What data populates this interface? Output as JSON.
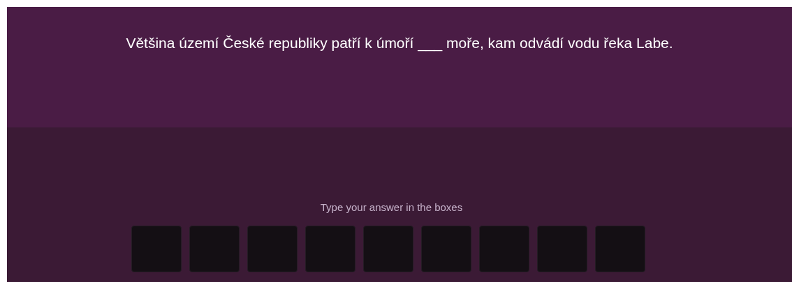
{
  "question": {
    "text": "Většina území České republiky patří k úmoří ___ moře, kam odvádí vodu řeka Labe."
  },
  "answer": {
    "hint": "Type your answer in the boxes",
    "boxes": [
      {
        "kind": "letter"
      },
      {
        "kind": "letter"
      },
      {
        "kind": "letter"
      },
      {
        "kind": "letter"
      },
      {
        "kind": "letter"
      },
      {
        "kind": "letter"
      },
      {
        "kind": "letter"
      },
      {
        "kind": "letter"
      },
      {
        "kind": "letter"
      }
    ]
  }
}
